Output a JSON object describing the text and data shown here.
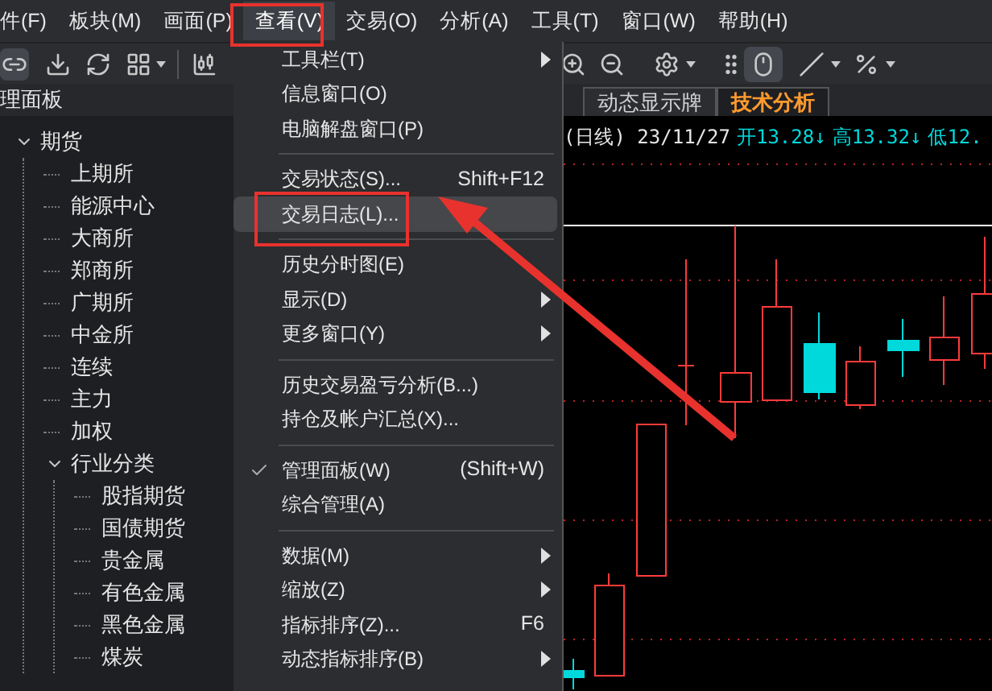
{
  "menubar": [
    {
      "label": "件(F)",
      "selected": false
    },
    {
      "label": "板块(M)",
      "selected": false
    },
    {
      "label": "画面(P)",
      "selected": false
    },
    {
      "label": "查看(V)",
      "selected": true
    },
    {
      "label": "交易(O)",
      "selected": false
    },
    {
      "label": "分析(A)",
      "selected": false
    },
    {
      "label": "工具(T)",
      "selected": false
    },
    {
      "label": "窗口(W)",
      "selected": false
    },
    {
      "label": "帮助(H)",
      "selected": false
    }
  ],
  "panel": {
    "title": "理面板",
    "tree": [
      {
        "label": "期货",
        "expanded": true,
        "children": [
          {
            "label": "上期所"
          },
          {
            "label": "能源中心"
          },
          {
            "label": "大商所"
          },
          {
            "label": "郑商所"
          },
          {
            "label": "广期所"
          },
          {
            "label": "中金所"
          },
          {
            "label": "连续"
          },
          {
            "label": "主力"
          },
          {
            "label": "加权"
          },
          {
            "label": "行业分类",
            "expanded": true,
            "children": [
              {
                "label": "股指期货"
              },
              {
                "label": "国债期货"
              },
              {
                "label": "贵金属"
              },
              {
                "label": "有色金属"
              },
              {
                "label": "黑色金属"
              },
              {
                "label": "煤炭"
              }
            ]
          }
        ]
      }
    ]
  },
  "menu": [
    {
      "kind": "item",
      "label": "工具栏(T)",
      "submenu": true,
      "checked": false,
      "selected": false
    },
    {
      "kind": "item",
      "label": "信息窗口(O)",
      "submenu": false,
      "checked": false,
      "selected": false
    },
    {
      "kind": "item",
      "label": "电脑解盘窗口(P)",
      "submenu": false,
      "checked": false,
      "selected": false
    },
    {
      "kind": "separator"
    },
    {
      "kind": "item",
      "label": "交易状态(S)...",
      "shortcut": "Shift+F12",
      "submenu": false,
      "checked": false,
      "selected": false
    },
    {
      "kind": "item",
      "label": "交易日志(L)...",
      "submenu": false,
      "checked": false,
      "selected": true
    },
    {
      "kind": "separator"
    },
    {
      "kind": "item",
      "label": "历史分时图(E)",
      "submenu": false,
      "checked": false,
      "selected": false
    },
    {
      "kind": "item",
      "label": "显示(D)",
      "submenu": true,
      "checked": false,
      "selected": false
    },
    {
      "kind": "item",
      "label": "更多窗口(Y)",
      "submenu": true,
      "checked": false,
      "selected": false
    },
    {
      "kind": "separator"
    },
    {
      "kind": "item",
      "label": "历史交易盈亏分析(B...)",
      "submenu": false,
      "checked": false,
      "selected": false
    },
    {
      "kind": "item",
      "label": "持仓及帐户汇总(X)...",
      "submenu": false,
      "checked": false,
      "selected": false
    },
    {
      "kind": "separator"
    },
    {
      "kind": "item",
      "label": "管理面板(W)",
      "shortcut": "(Shift+W)",
      "submenu": false,
      "checked": true,
      "selected": false
    },
    {
      "kind": "item",
      "label": "综合管理(A)",
      "submenu": false,
      "checked": false,
      "selected": false
    },
    {
      "kind": "separator"
    },
    {
      "kind": "item",
      "label": "数据(M)",
      "submenu": true,
      "checked": false,
      "selected": false
    },
    {
      "kind": "item",
      "label": "缩放(Z)",
      "submenu": true,
      "checked": false,
      "selected": false
    },
    {
      "kind": "item",
      "label": "指标排序(Z)...",
      "shortcut": "F6",
      "submenu": false,
      "checked": false,
      "selected": false
    },
    {
      "kind": "item",
      "label": "动态指标排序(B)",
      "submenu": true,
      "checked": false,
      "selected": false
    }
  ],
  "tabs": [
    {
      "label": "动态显示牌",
      "selected": false
    },
    {
      "label": "技术分析",
      "selected": true
    }
  ],
  "quote": {
    "title": "(日线) 23/11/27",
    "values": [
      "开13.28↓",
      "高13.32↓",
      "低12."
    ]
  }
}
